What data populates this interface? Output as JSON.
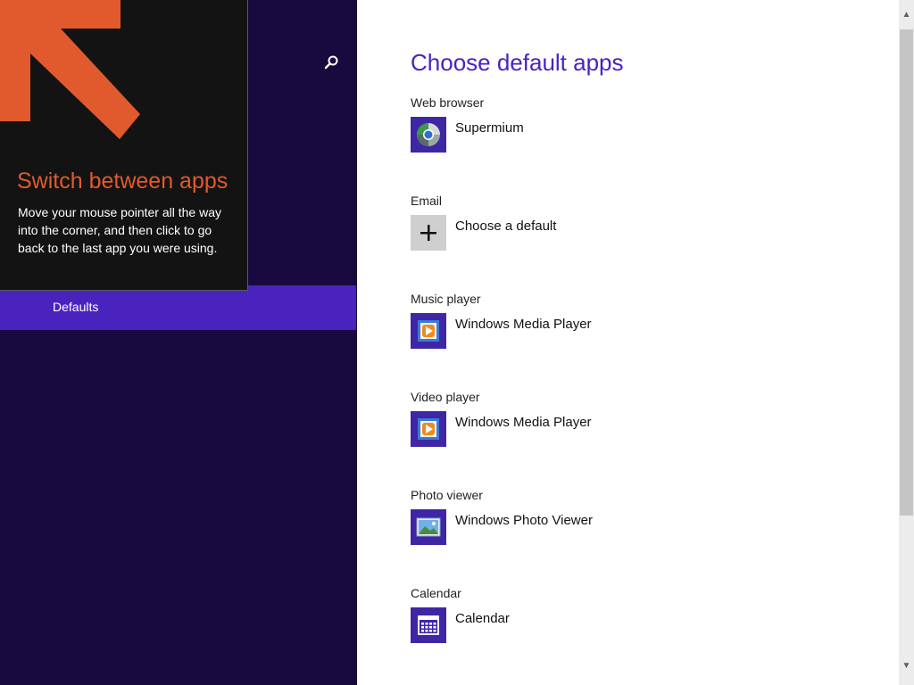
{
  "sidebar": {
    "selected_item": "Defaults",
    "search_icon": "search-icon"
  },
  "tip": {
    "title": "Switch between apps",
    "body": "Move your mouse pointer all the way into the corner, and then click to go back to the last app you were using.",
    "arrow_color": "#e15a2d"
  },
  "main": {
    "title": "Choose default apps",
    "sections": [
      {
        "label": "Web browser",
        "app": "Supermium",
        "icon": "browser-icon"
      },
      {
        "label": "Email",
        "app": "Choose a default",
        "icon": "plus-icon"
      },
      {
        "label": "Music player",
        "app": "Windows Media Player",
        "icon": "media-player-icon"
      },
      {
        "label": "Video player",
        "app": "Windows Media Player",
        "icon": "media-player-icon"
      },
      {
        "label": "Photo viewer",
        "app": "Windows Photo Viewer",
        "icon": "photo-viewer-icon"
      },
      {
        "label": "Calendar",
        "app": "Calendar",
        "icon": "calendar-icon"
      }
    ]
  },
  "colors": {
    "accent": "#4a23be",
    "sidebar_bg": "#180a3e",
    "tip_bg": "#131313",
    "tip_title": "#e15a2d"
  }
}
